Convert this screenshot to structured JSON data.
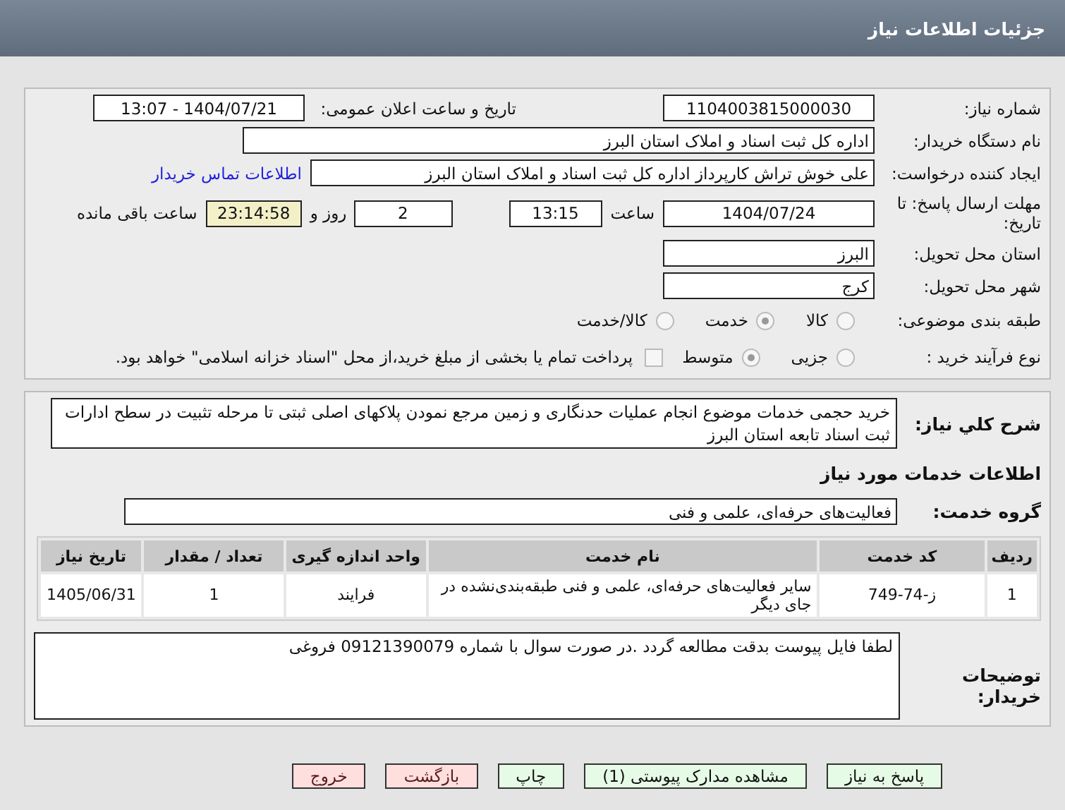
{
  "header": {
    "title": "جزئیات اطلاعات نیاز"
  },
  "need_number": {
    "label": "شماره نیاز:",
    "value": "1104003815000030"
  },
  "announce": {
    "label": "تاریخ و ساعت اعلان عمومی:",
    "value": "1404/07/21 - 13:07"
  },
  "buyer_org": {
    "label": "نام دستگاه خریدار:",
    "value": "اداره کل ثبت اسناد و املاک استان البرز"
  },
  "requester": {
    "label": "ایجاد کننده درخواست:",
    "value": "علی خوش تراش کارپرداز اداره کل ثبت اسناد و املاک استان البرز",
    "link": "اطلاعات تماس خریدار"
  },
  "deadline": {
    "label": "مهلت ارسال پاسخ: تا تاریخ:",
    "date": "1404/07/24",
    "time_label": "ساعت",
    "time": "13:15",
    "days": "2",
    "days_label": "روز و",
    "remaining": "23:14:58",
    "remaining_label": "ساعت باقی مانده"
  },
  "province": {
    "label": "استان محل تحویل:",
    "value": "البرز"
  },
  "city": {
    "label": "شهر محل تحویل:",
    "value": "کرج"
  },
  "category": {
    "label": "طبقه بندی موضوعی:",
    "options": [
      {
        "label": "کالا",
        "selected": false
      },
      {
        "label": "خدمت",
        "selected": true
      },
      {
        "label": "کالا/خدمت",
        "selected": false
      }
    ]
  },
  "process": {
    "label": "نوع فرآیند خرید :",
    "options": [
      {
        "label": "جزیی",
        "selected": false
      },
      {
        "label": "متوسط",
        "selected": true
      }
    ],
    "payment": {
      "label": "پرداخت تمام یا بخشی از مبلغ خرید،از محل \"اسناد خزانه اسلامی\" خواهد بود.",
      "checked": false
    }
  },
  "description": {
    "label": "شرح کلي نیاز:",
    "text": "خرید حجمی خدمات موضوع  انجام عملیات حدنگاری و زمین مرجع نمودن پلاکهای اصلی ثبتی تا مرحله تثبیت در سطح ادارات ثبت اسناد تابعه استان البرز"
  },
  "services_heading": "اطلاعات خدمات مورد نیاز",
  "service_group": {
    "label": "گروه خدمت:",
    "value": "فعالیت‌های حرفه‌ای، علمی و فنی"
  },
  "table": {
    "columns": [
      "ردیف",
      "کد خدمت",
      "نام خدمت",
      "واحد اندازه گیری",
      "تعداد / مقدار",
      "تاریخ نیاز"
    ],
    "rows": [
      [
        "1",
        "ز-74-749",
        "سایر فعالیت‌های حرفه‌ای، علمی و فنی طبقه‌بندی‌نشده در جای دیگر",
        "فرایند",
        "1",
        "1405/06/31"
      ]
    ]
  },
  "buyer_notes": {
    "label": "توضیحات خریدار:",
    "text": "لطفا فایل پیوست بدقت مطالعه گردد .در صورت سوال با شماره 09121390079 فروغی"
  },
  "buttons": [
    {
      "label": "پاسخ به نیاز",
      "kind": "action"
    },
    {
      "label": "مشاهده مدارک پیوستی (1)",
      "kind": "action"
    },
    {
      "label": "چاپ",
      "kind": "action"
    },
    {
      "label": "بازگشت",
      "kind": "exit"
    },
    {
      "label": "خروج",
      "kind": "exit"
    }
  ]
}
